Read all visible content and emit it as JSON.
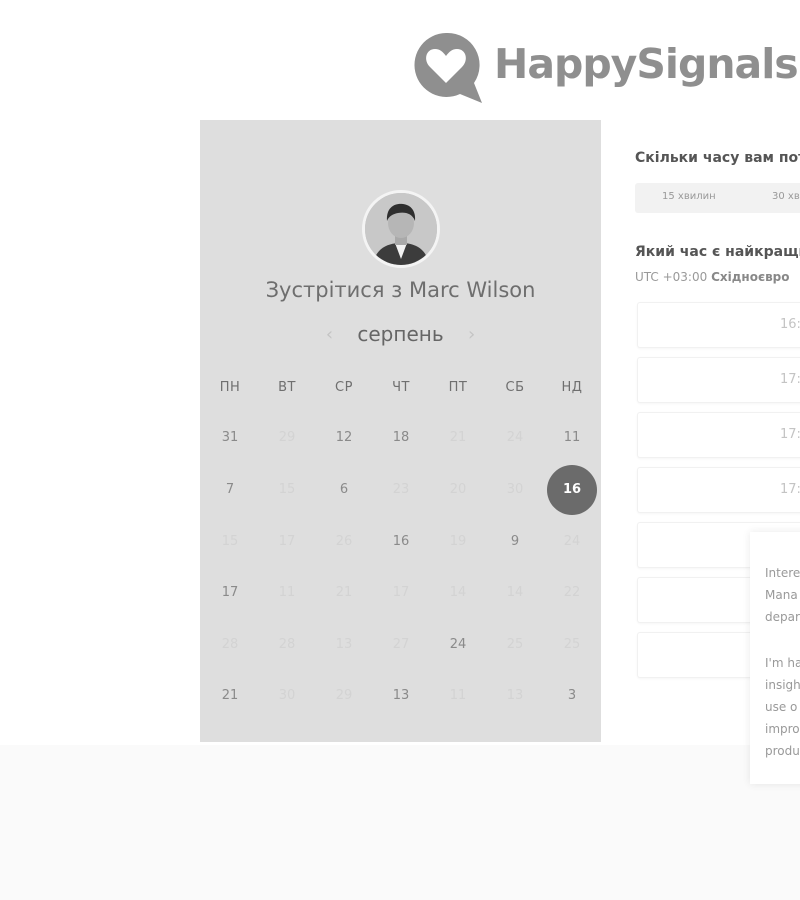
{
  "brand": {
    "name": "HappySignals"
  },
  "calendar": {
    "title": "Зустрітися з Marc Wilson",
    "month": "серпень",
    "prev_icon": "chevron-left-icon",
    "next_icon": "chevron-right-icon",
    "weekdays": [
      "ПН",
      "ВТ",
      "СР",
      "ЧТ",
      "ПТ",
      "СБ",
      "НД"
    ],
    "weeks": [
      [
        "31",
        "29",
        "12",
        "18",
        "21",
        "24",
        "11"
      ],
      [
        "7",
        "15",
        "6",
        "23",
        "20",
        "30",
        "16"
      ],
      [
        "15",
        "17",
        "26",
        "16",
        "19",
        "9",
        "24"
      ],
      [
        "17",
        "11",
        "21",
        "17",
        "14",
        "14",
        "22"
      ],
      [
        "28",
        "28",
        "13",
        "27",
        "24",
        "25",
        "25"
      ],
      [
        "21",
        "30",
        "29",
        "13",
        "11",
        "13",
        "3"
      ]
    ],
    "selected": "16"
  },
  "scheduler": {
    "duration_question": "Скільки часу вам пот",
    "durations": [
      "15 хвилин",
      "30 хв"
    ],
    "time_question": "Який час є найкращи",
    "timezone_offset": "UTC +03:00",
    "timezone_name": "Східноєвро",
    "slots": [
      "16:",
      "17:",
      "17:",
      "17:",
      "",
      "",
      ""
    ]
  },
  "bio": {
    "lines": [
      "Intere",
      "Mana",
      "depar",
      "I'm ha",
      "insigh",
      "use o",
      "impro",
      "produ"
    ]
  }
}
